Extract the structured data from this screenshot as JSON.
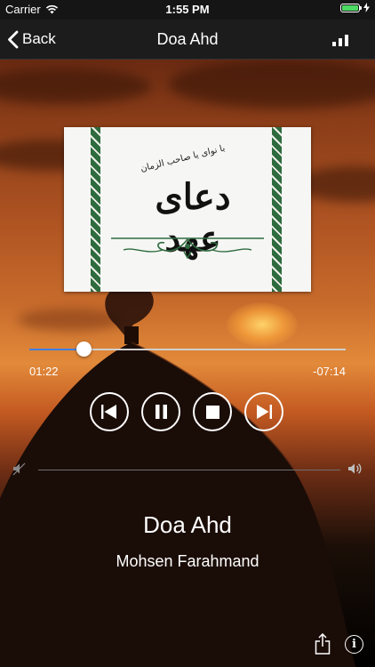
{
  "status_bar": {
    "carrier": "Carrier",
    "time": "1:55 PM",
    "icons": [
      "wifi-icon",
      "battery-icon",
      "charging-bolt-icon"
    ]
  },
  "nav": {
    "back_label": "Back",
    "title": "Doa Ahd",
    "right_icon": "signal-bars-icon"
  },
  "album_art": {
    "title": "دعای عهد",
    "subtitle": "با نوای یا صاحب الزمان"
  },
  "player": {
    "elapsed": "01:22",
    "remaining": "-07:14",
    "progress": 0.17,
    "progress_color": "#3f7ee0",
    "controls": [
      "previous-track-icon",
      "pause-icon",
      "stop-icon",
      "next-track-icon"
    ]
  },
  "volume": {
    "low_icon": "volume-low-icon",
    "high_icon": "volume-high-icon"
  },
  "track": {
    "title": "Doa Ahd",
    "artist": "Mohsen Farahmand"
  },
  "bottom": {
    "icons": [
      "share-icon",
      "info-icon"
    ],
    "info_glyph": "i"
  }
}
